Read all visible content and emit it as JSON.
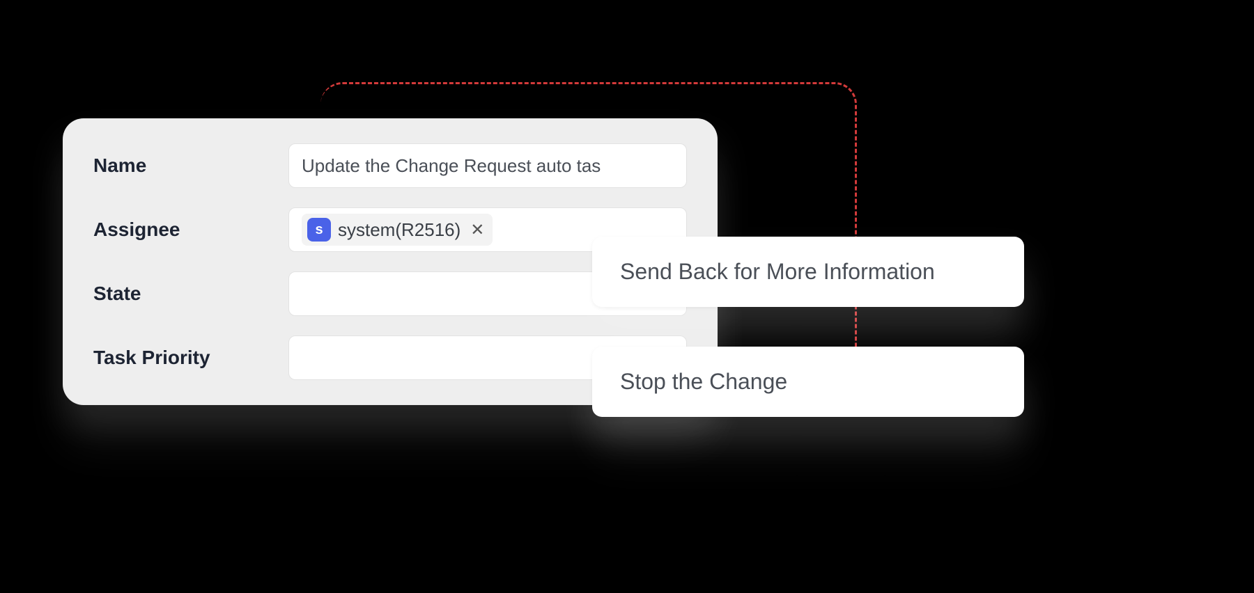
{
  "form": {
    "fields": {
      "name": {
        "label": "Name",
        "value": "Update the Change Request auto tas"
      },
      "assignee": {
        "label": "Assignee",
        "chip": {
          "avatar_letter": "s",
          "text": "system(R2516)"
        }
      },
      "state": {
        "label": "State",
        "value": ""
      },
      "task_priority": {
        "label": "Task Priority",
        "value": ""
      }
    }
  },
  "actions": {
    "send_back": "Send Back for More Information",
    "stop_change": "Stop the Change"
  }
}
